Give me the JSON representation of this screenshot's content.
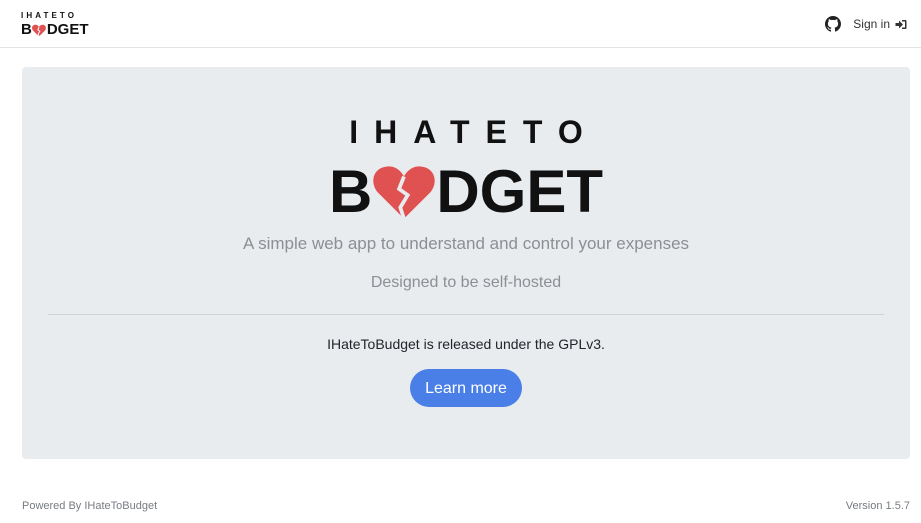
{
  "navbar": {
    "logo_top": "IHATETO",
    "logo_bottom_before": "B",
    "logo_bottom_after": "DGET",
    "github_icon": "github-icon",
    "signin_label": "Sign in",
    "signin_icon": "sign-in-icon"
  },
  "hero": {
    "logo_top": "IHATETO",
    "logo_bottom_before": "B",
    "logo_bottom_after": "DGET",
    "logo_icon": "broken-heart-icon",
    "tagline": "A simple web app to understand and control your expenses",
    "subtitle": "Designed to be self-hosted",
    "license_text": "IHateToBudget is released under the GPLv3.",
    "button_label": "Learn more"
  },
  "footer": {
    "powered_by": "Powered By IHateToBudget",
    "version": "Version 1.5.7"
  },
  "colors": {
    "heart": "#e05252",
    "button": "#4a7fe8",
    "hero_bg": "#e9ecef"
  }
}
